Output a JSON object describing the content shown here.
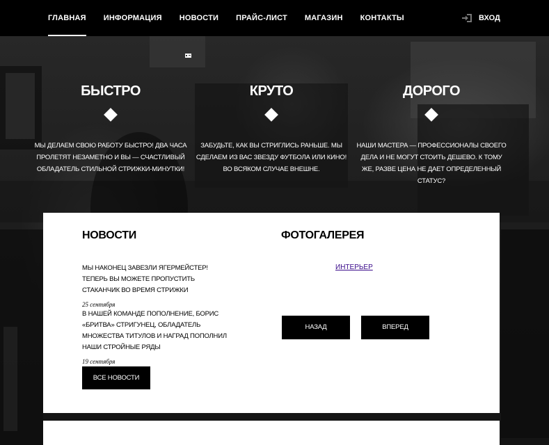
{
  "nav": {
    "items": [
      {
        "label": "Главная",
        "active": true
      },
      {
        "label": "Информация"
      },
      {
        "label": "Новости"
      },
      {
        "label": "Прайс-лист"
      },
      {
        "label": "Магазин"
      },
      {
        "label": "Контакты"
      }
    ],
    "login_label": "Вход",
    "login_icon": "login-icon"
  },
  "features": [
    {
      "title": "БЫСТРО",
      "text": "Мы делаем свою работу быстро! Два часа пролетят незаметно и вы — счастливый обладатель стильной стрижки-минутки!"
    },
    {
      "title": "КРУТО",
      "text": "Забудьте, как вы стриглись раньше. Мы сделаем из вас звезду футбола или кино! Во всяком случае внешне."
    },
    {
      "title": "ДОРОГО",
      "text": "Наши мастера — профессионалы своего дела и не могут стоить дешево. К тому же, разве цена не дает определенный статус?"
    }
  ],
  "news": {
    "title": "НОВОСТИ",
    "items": [
      {
        "text": "Мы наконец завезли Ягермейстер! Теперь вы можете пропустить стаканчик во время стрижки",
        "date": "25 сентября"
      },
      {
        "text": "В нашей команде пополнение, Борис «Бритва» Стригунец, обладатель множества титулов и наград пополнил наши стройные ряды",
        "date": "19 сентября"
      }
    ],
    "all_button": "Все новости"
  },
  "gallery": {
    "title": "ФОТОГАЛЕРЕЯ",
    "link_label": "Интерьер",
    "prev_button": "Назад",
    "next_button": "Вперед"
  },
  "colors": {
    "topbar": "#000000",
    "panel": "#ffffff",
    "button": "#000000",
    "link": "#3a0a8a"
  }
}
